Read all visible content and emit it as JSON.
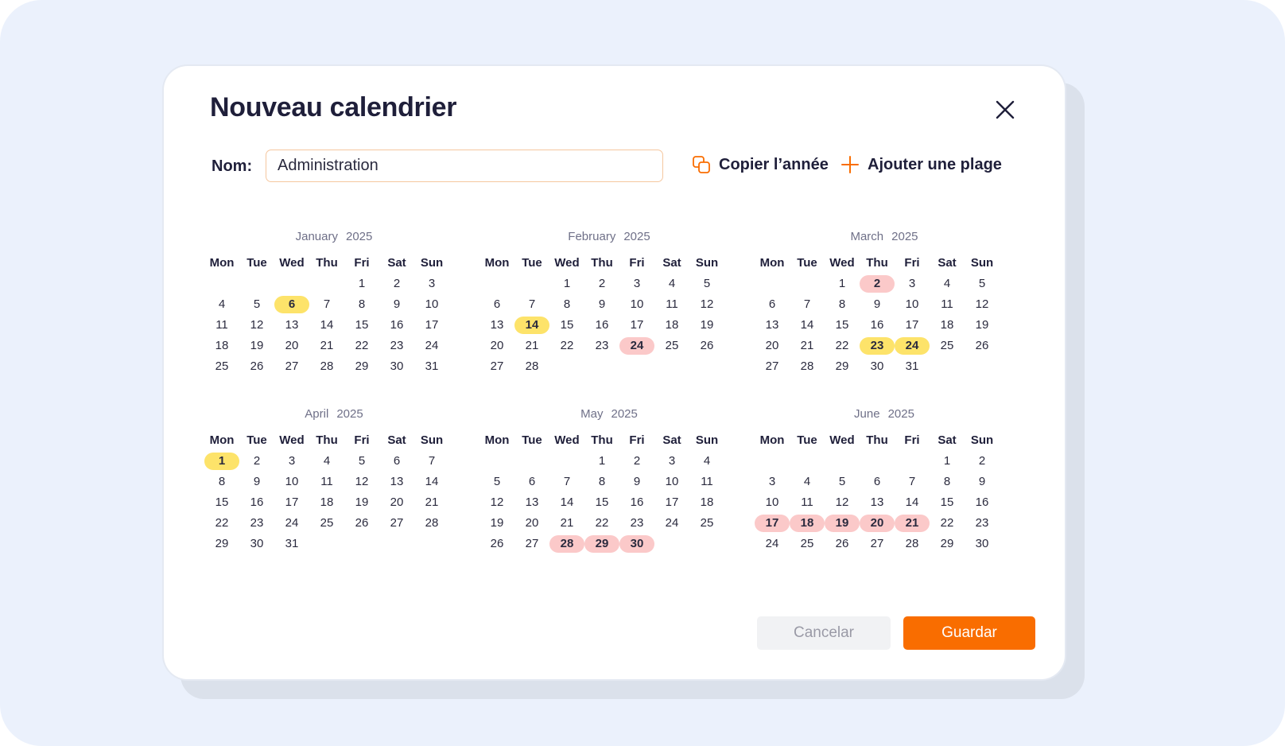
{
  "modal": {
    "title": "Nouveau calendrier",
    "name_label": "Nom:",
    "name_value": "Administration",
    "copy_year_label": "Copier l’année",
    "add_range_label": "Ajouter une plage",
    "cancel_label": "Cancelar",
    "save_label": "Guardar"
  },
  "weekdays": [
    "Mon",
    "Tue",
    "Wed",
    "Thu",
    "Fri",
    "Sat",
    "Sun"
  ],
  "colors": {
    "accent": "#f96d00",
    "highlight_yellow": "#fde36a",
    "highlight_red": "#fbc9c9"
  },
  "months": [
    {
      "name": "January",
      "year": "2025",
      "offset": 4,
      "days": 31,
      "yellow": [
        6
      ],
      "red": []
    },
    {
      "name": "February",
      "year": "2025",
      "offset": 2,
      "days": 28,
      "yellow": [
        14
      ],
      "red": [
        24
      ]
    },
    {
      "name": "March",
      "year": "2025",
      "offset": 2,
      "days": 31,
      "yellow": [
        23,
        24
      ],
      "red": [
        2
      ]
    },
    {
      "name": "April",
      "year": "2025",
      "offset": 0,
      "days": 31,
      "yellow": [
        1
      ],
      "red": []
    },
    {
      "name": "May",
      "year": "2025",
      "offset": 3,
      "days": 30,
      "yellow": [],
      "red": [
        28,
        29,
        30
      ]
    },
    {
      "name": "June",
      "year": "2025",
      "offset": 5,
      "days": 30,
      "yellow": [],
      "red": [
        17,
        18,
        19,
        20,
        21
      ]
    }
  ]
}
